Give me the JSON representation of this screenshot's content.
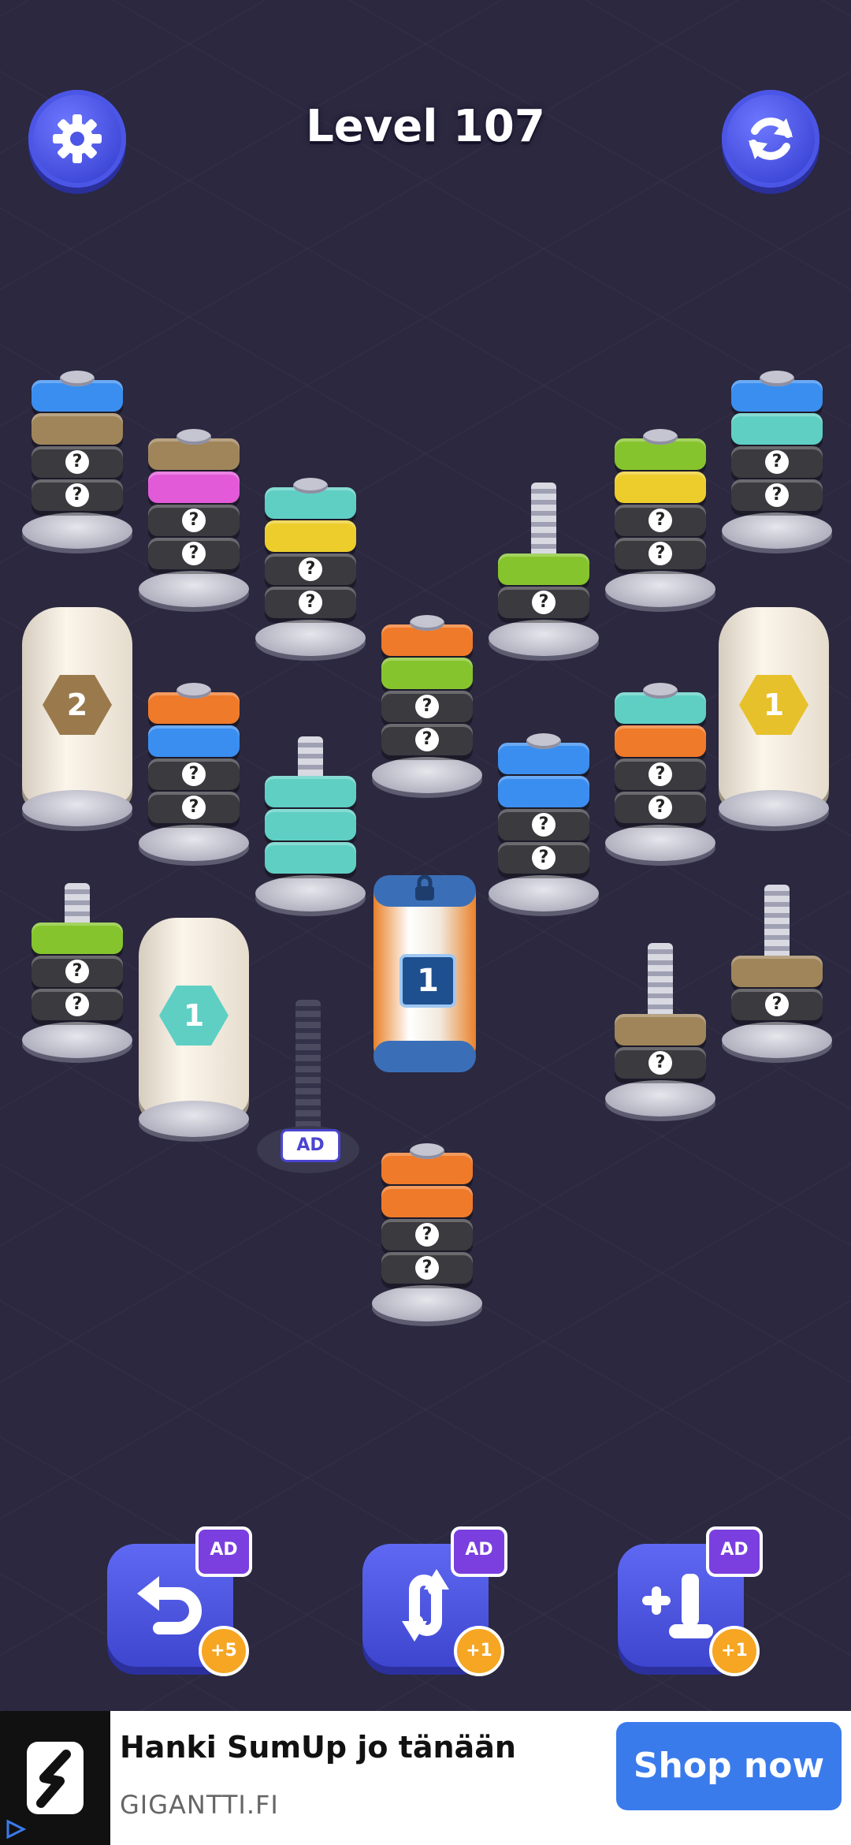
{
  "header": {
    "title": "Level 107",
    "settings_icon": "gear-icon",
    "restart_icon": "refresh-icon"
  },
  "colors": {
    "blue": "#3a8ef0",
    "brown": "#a0855a",
    "dark": "#3a3a3f",
    "pink": "#e25ad8",
    "teal": "#5fcfc4",
    "yellow": "#eccd2b",
    "green": "#86c42d",
    "orange": "#ef7a2a"
  },
  "columns": [
    {
      "id": "c1",
      "nuts": [
        "blue",
        "brown",
        "dark?",
        "dark?"
      ]
    },
    {
      "id": "c2",
      "nuts": [
        "brown",
        "pink",
        "dark?",
        "dark?"
      ]
    },
    {
      "id": "c3",
      "nuts": [
        "teal",
        "yellow",
        "dark?",
        "dark?"
      ]
    },
    {
      "id": "c4",
      "nuts": [
        "green",
        "dark?"
      ]
    },
    {
      "id": "c5",
      "nuts": [
        "green",
        "yellow",
        "dark?",
        "dark?"
      ]
    },
    {
      "id": "c6",
      "nuts": [
        "blue",
        "teal",
        "dark?",
        "dark?"
      ]
    },
    {
      "id": "c7",
      "nuts": [
        "orange",
        "blue",
        "dark?",
        "dark?"
      ]
    },
    {
      "id": "c8",
      "nuts": [
        "teal",
        "teal",
        "teal"
      ]
    },
    {
      "id": "c9",
      "nuts": [
        "orange",
        "green",
        "dark?",
        "dark?"
      ]
    },
    {
      "id": "c10",
      "nuts": [
        "blue",
        "blue",
        "dark?",
        "dark?"
      ]
    },
    {
      "id": "c11",
      "nuts": [
        "teal",
        "orange",
        "dark?",
        "dark?"
      ]
    },
    {
      "id": "c12",
      "nuts": [
        "green",
        "dark?",
        "dark?"
      ]
    },
    {
      "id": "c13",
      "nuts": [
        "brown",
        "dark?"
      ]
    },
    {
      "id": "c14",
      "nuts": [
        "brown",
        "dark?"
      ]
    },
    {
      "id": "c15",
      "nuts": [
        "orange",
        "orange",
        "dark?",
        "dark?"
      ]
    }
  ],
  "covers": [
    {
      "label": "2",
      "color": "#9a7a4c"
    },
    {
      "label": "1",
      "color": "#e7c12c"
    },
    {
      "label": "1",
      "color": "#5fcfc4"
    }
  ],
  "locked_column": {
    "label": "1",
    "icon": "lock-icon"
  },
  "ad_bolt_label": "AD",
  "tools": [
    {
      "name": "undo",
      "icon": "undo-icon",
      "ad": "AD",
      "bonus": "+5"
    },
    {
      "name": "shuffle",
      "icon": "shuffle-icon",
      "ad": "AD",
      "bonus": "+1"
    },
    {
      "name": "add-bolt",
      "icon": "add-bolt-icon",
      "ad": "AD",
      "bonus": "+1"
    }
  ],
  "banner": {
    "headline": "Hanki SumUp jo tänään",
    "domain": "GIGANTTI.FI",
    "cta": "Shop now"
  }
}
